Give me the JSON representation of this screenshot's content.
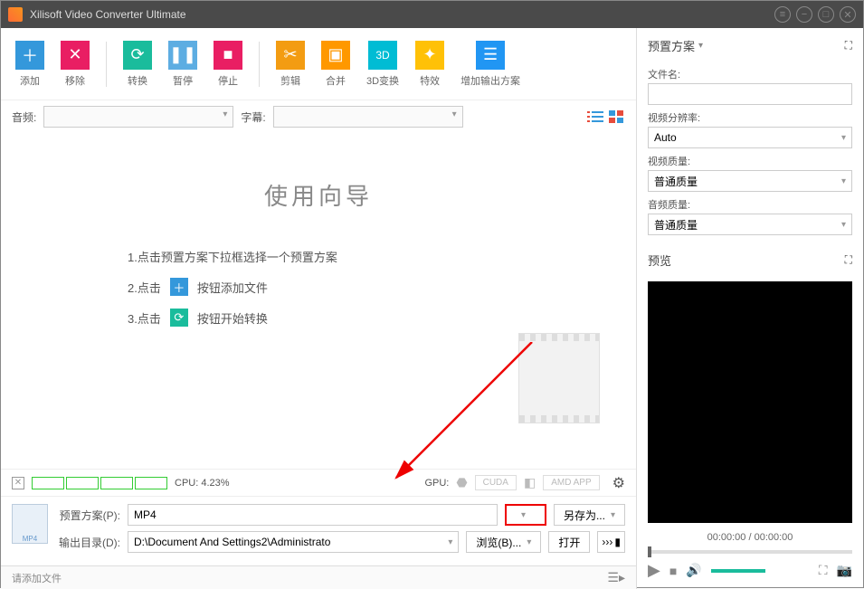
{
  "titlebar": {
    "title": "Xilisoft Video Converter Ultimate"
  },
  "toolbar": {
    "add": "添加",
    "remove": "移除",
    "convert": "转换",
    "pause": "暂停",
    "stop": "停止",
    "cut": "剪辑",
    "merge": "合并",
    "threed": "3D变换",
    "effect": "特效",
    "addoutput": "增加输出方案"
  },
  "filters": {
    "audio_label": "音频:",
    "subtitle_label": "字幕:"
  },
  "wizard": {
    "title": "使用向导",
    "step1": "1.点击预置方案下拉框选择一个预置方案",
    "step2a": "2.点击",
    "step2b": "按钮添加文件",
    "step3a": "3.点击",
    "step3b": "按钮开始转换"
  },
  "status": {
    "cpu_label": "CPU: 4.23%",
    "gpu_label": "GPU:",
    "cuda": "CUDA",
    "amd": "AMD APP"
  },
  "bottom": {
    "profile_label": "预置方案(P):",
    "profile_value": "MP4",
    "saveas": "另存为...",
    "output_label": "输出目录(D):",
    "output_value": "D:\\Document And Settings2\\Administrato",
    "browse": "浏览(B)...",
    "open": "打开",
    "more": "›››"
  },
  "footer": {
    "hint": "请添加文件"
  },
  "panel": {
    "preset_title": "预置方案",
    "filename_label": "文件名:",
    "resolution_label": "视频分辨率:",
    "resolution_value": "Auto",
    "vquality_label": "视频质量:",
    "vquality_value": "普通质量",
    "aquality_label": "音频质量:",
    "aquality_value": "普通质量",
    "preview_title": "预览",
    "time": "00:00:00 / 00:00:00"
  }
}
